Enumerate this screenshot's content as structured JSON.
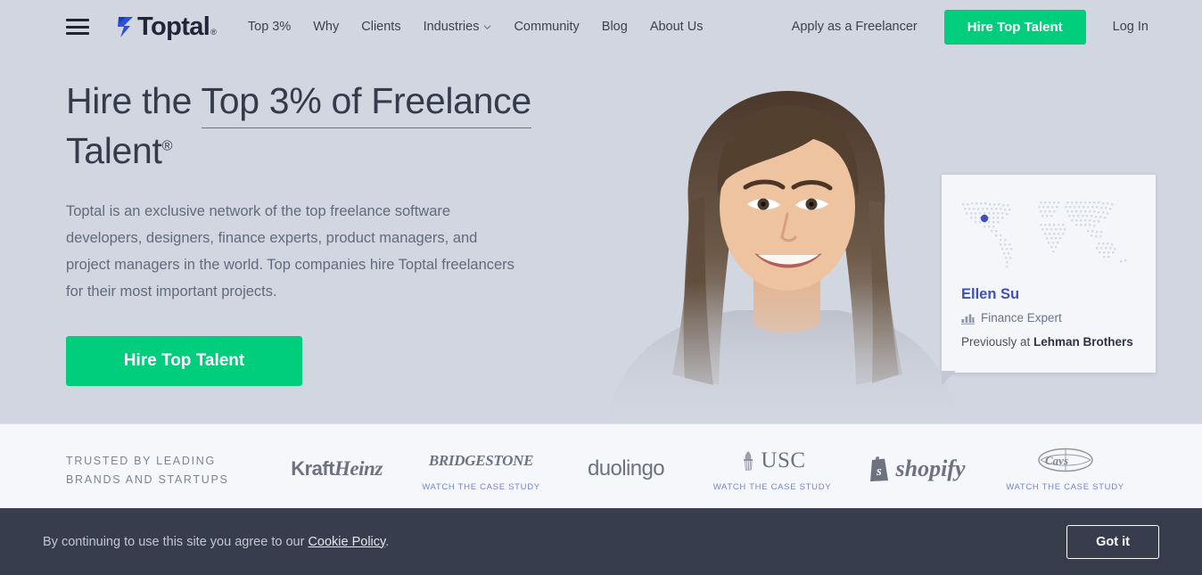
{
  "brand": {
    "logo_text": "Toptal",
    "logo_registered": "®",
    "accent_green": "#00ce7c",
    "logo_blue": "#2b51d6",
    "hero_bg": "#d2d6e0"
  },
  "header": {
    "menu_icon": "hamburger-menu-icon",
    "nav": [
      {
        "label": "Top 3%",
        "has_dropdown": false
      },
      {
        "label": "Why",
        "has_dropdown": false
      },
      {
        "label": "Clients",
        "has_dropdown": false
      },
      {
        "label": "Industries",
        "has_dropdown": true
      },
      {
        "label": "Community",
        "has_dropdown": false
      },
      {
        "label": "Blog",
        "has_dropdown": false
      },
      {
        "label": "About Us",
        "has_dropdown": false
      }
    ],
    "apply_label": "Apply as a Freelancer",
    "hire_label": "Hire Top Talent",
    "login_label": "Log In"
  },
  "hero": {
    "headline_part1": "Hire the ",
    "headline_underlined": "Top 3% of Freelance",
    "headline_part2": " Talent",
    "headline_sup": "®",
    "paragraph": "Toptal is an exclusive network of the top freelance software developers, designers, finance experts, product managers, and project managers in the world. Top companies hire Toptal freelancers for their most important projects.",
    "cta_label": "Hire Top Talent",
    "photo_alt": "smiling-woman-portrait"
  },
  "profile_card": {
    "map_icon": "dotted-world-map",
    "name": "Ellen Su",
    "role_icon": "bar-chart-icon",
    "role": "Finance Expert",
    "previously_prefix": "Previously at ",
    "previously_company": "Lehman Brothers"
  },
  "brands": {
    "trusted_line1": "TRUSTED BY LEADING",
    "trusted_line2": "BRANDS AND STARTUPS",
    "case_study_label": "WATCH THE CASE STUDY",
    "items": [
      {
        "name": "KraftHeinz",
        "kraft": "Kraft",
        "heinz": "Heinz",
        "case_study": false
      },
      {
        "name": "BRIDGESTONE",
        "case_study": true
      },
      {
        "name": "duolingo",
        "case_study": false
      },
      {
        "name": "USC",
        "case_study": true
      },
      {
        "name": "shopify",
        "case_study": false
      },
      {
        "name": "Cleveland Cavaliers",
        "case_study": true
      }
    ]
  },
  "cookie_banner": {
    "text_prefix": "By continuing to use this site you agree to our ",
    "link_label": "Cookie Policy",
    "text_suffix": ".",
    "button_label": "Got it"
  }
}
